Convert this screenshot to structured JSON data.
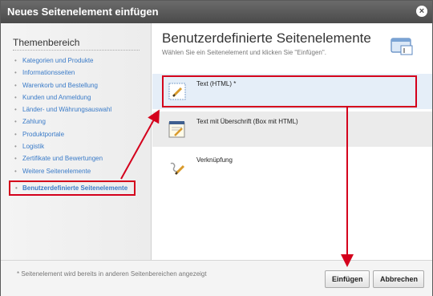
{
  "dialog": {
    "title": "Neues Seitenelement einfügen",
    "close_glyph": "×"
  },
  "sidebar": {
    "heading": "Themenbereich",
    "items": [
      {
        "label": "Kategorien und Produkte"
      },
      {
        "label": "Informationsseiten"
      },
      {
        "label": "Warenkorb und Bestellung"
      },
      {
        "label": "Kunden und Anmeldung"
      },
      {
        "label": "Länder- und Währungsauswahl"
      },
      {
        "label": "Zahlung"
      },
      {
        "label": "Produktportale"
      },
      {
        "label": "Logistik"
      },
      {
        "label": "Zertifikate und Bewertungen"
      },
      {
        "label": "Weitere Seitenelemente"
      }
    ],
    "active_item": "Benutzerdefinierte Seitenelemente"
  },
  "main": {
    "title": "Benutzerdefinierte Seitenelemente",
    "subtitle": "Wählen Sie ein Seitenelement und klicken Sie \"Einfügen\".",
    "elements": [
      {
        "label": "Text (HTML) *",
        "icon": "pencil-note-icon",
        "selected": true
      },
      {
        "label": "Text mit Überschrift (Box mit HTML)",
        "icon": "notepad-icon",
        "selected": false
      },
      {
        "label": "Verknüpfung",
        "icon": "link-pen-icon",
        "selected": false
      }
    ]
  },
  "footer": {
    "note": "* Seitenelement wird bereits in anderen Seitenbereichen angezeigt",
    "insert_label": "Einfügen",
    "cancel_label": "Abbrechen"
  },
  "colors": {
    "accent": "#d4001c",
    "link": "#3a7bc8",
    "titlebar": "#555555"
  }
}
